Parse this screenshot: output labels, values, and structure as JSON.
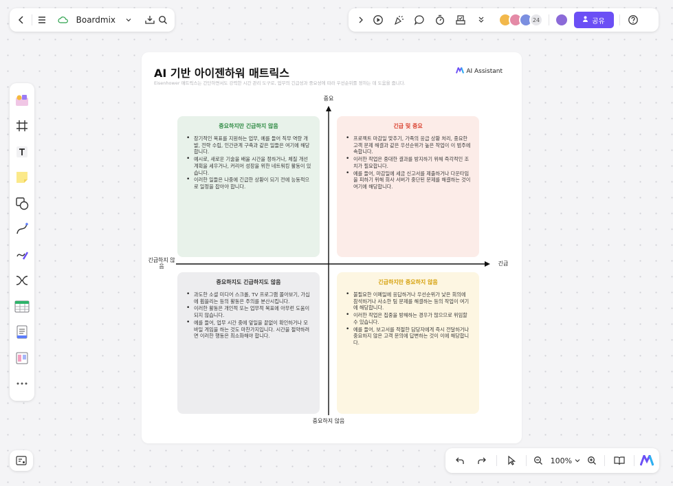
{
  "app": {
    "brand": "Boardmix",
    "share_label": "공유",
    "collaborator_count": "24"
  },
  "zoom": {
    "level": "100%"
  },
  "board": {
    "title": "AI 기반 아이젠하워 매트릭스",
    "subtitle": "Eisenhower 매트릭스는 간단하면서도 강력한 시간 관리 도구로, 업무의 긴급성과 중요성에 따라 우선순위를 정하는 데 도움을 줍니다.",
    "ai_assistant": "AI Assistant",
    "axis": {
      "top": "중요",
      "bottom": "중요하지 않음",
      "left": "긴급하지 않음",
      "right": "긴급"
    },
    "quadrants": {
      "top_left": {
        "title": "중요하지만 긴급하지 않음",
        "items": [
          "장기적인 목표를 지원하는 업무, 예를 들어 직무 역량 개발, 전략 수립, 인간관계 구축과 같은 일들은 여기에 해당합니다.",
          "예시로, 새로운 기술을 배울 시간을 정하거나, 체질 개선 계획을 세우거나, 커리어 성장을 위한 네트워킹 활동이 있습니다.",
          "이러한 일들은 나중에 긴급한 상황이 되기 전에 능동적으로 일정을 잡아야 합니다."
        ]
      },
      "top_right": {
        "title": "긴급 및 중요",
        "items": [
          "프로젝트 마감일 맞추기, 가족의 응급 상황 처리, 중요한 고객 문제 해결과 같은 우선순위가 높은 작업이 이 범주에 속합니다.",
          "이러한 작업은 중대한 결과를 방지하기 위해 즉각적인 조치가 필요합니다.",
          "예를 들어, 마감일에 세금 신고서를 제출하거나 다운타임을 피하기 위해 회사 서버가 중단된 문제를 해결하는 것이 여기에 해당합니다."
        ]
      },
      "bottom_left": {
        "title": "중요하지도 긴급하지도 않음",
        "items": [
          "과도한 소셜 미디어 스크롤, TV 프로그램 몰아보기, 가십에 휩쓸리는 등의 활동은 주의를 분산시킵니다.",
          "이러한 활동은 개인적 또는 업무적 목표에 아무런 도움이 되지 않습니다.",
          "예를 들어, 업무 시간 중에 앞일을 끝없이 확인하거나 모바일 게임을 하는 것도 마찬가지입니다. 시간을 절약하려면 이러한 행동은 최소화해야 합니다."
        ]
      },
      "bottom_right": {
        "title": "긴급하지만 중요하지 않음",
        "items": [
          "불필요한 이메일에 응답하거나 우선순위가 낮은 회의에 참석하거나 사소한 팀 문제를 해결하는 등의 작업이 여기에 해당합니다.",
          "이러한 작업은 집중을 방해하는 경우가 많으므로 위임할 수 있습니다.",
          "예를 들어, 보고서를 적절한 담당자에게 즉시 전달하거나 중요하지 않은 고객 문의에 답변하는 것이 이에 해당합니다."
        ]
      }
    }
  },
  "colors": {
    "accent": "#6b4ff5",
    "q_top_left_bg": "#e8f2ea",
    "q_top_left_title": "#2e8a43",
    "q_top_right_bg": "#fcece8",
    "q_top_right_title": "#d9402e",
    "q_bottom_left_bg": "#ededef",
    "q_bottom_left_title": "#333333",
    "q_bottom_right_bg": "#fdf6e2",
    "q_bottom_right_title": "#d6a10e"
  },
  "icons": {
    "top_left": [
      "back-icon",
      "menu-icon",
      "cloud-icon",
      "chevron-down-icon",
      "export-icon",
      "search-icon"
    ],
    "top_right": [
      "expand-icon",
      "play-icon",
      "celebrate-icon",
      "comment-icon",
      "timer-icon",
      "vote-icon",
      "more-chevrons-icon",
      "help-icon"
    ],
    "left_tools": [
      "templates-icon",
      "frame-icon",
      "text-icon",
      "sticky-note-icon",
      "shape-icon",
      "connector-icon",
      "pen-icon",
      "mindmap-icon",
      "table-icon",
      "document-icon",
      "kanban-icon",
      "more-icon"
    ],
    "bottom": [
      "minimap-icon",
      "undo-icon",
      "redo-icon",
      "select-cursor-icon",
      "zoom-out-icon",
      "zoom-in-icon",
      "book-icon",
      "boardmix-ai-logo-icon"
    ]
  }
}
